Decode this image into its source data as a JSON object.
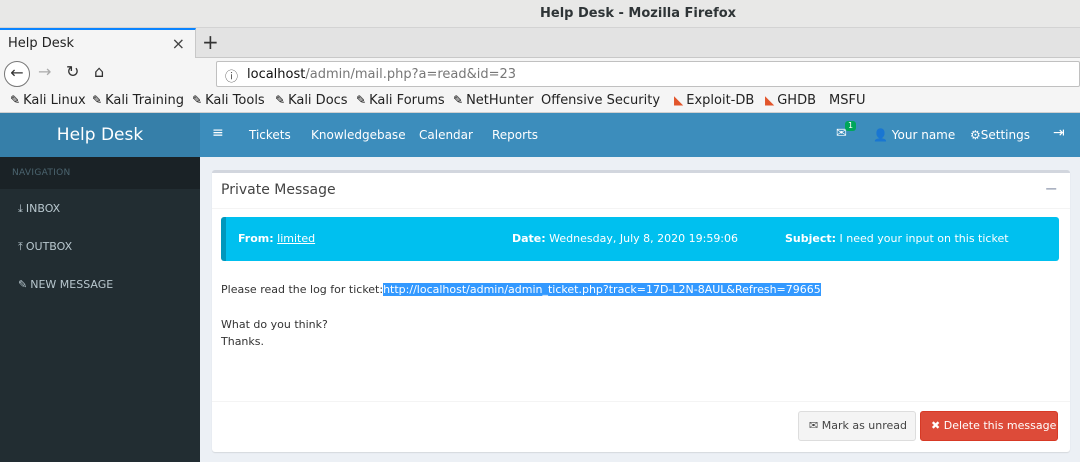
{
  "window": {
    "title": "Help Desk - Mozilla Firefox"
  },
  "tab": {
    "label": "Help Desk",
    "close": "×",
    "new": "+"
  },
  "nav": {
    "back": "←",
    "forward": "→",
    "reload": "↻",
    "home": "⌂",
    "info_icon": "ⓘ",
    "url_host": "localhost",
    "url_path": "/admin/mail.php?a=read&id=23"
  },
  "bookmarks": [
    {
      "icon": "dragon",
      "label": "Kali Linux"
    },
    {
      "icon": "dragon",
      "label": "Kali Training"
    },
    {
      "icon": "dragon",
      "label": "Kali Tools"
    },
    {
      "icon": "dragon",
      "label": "Kali Docs"
    },
    {
      "icon": "dragon",
      "label": "Kali Forums"
    },
    {
      "icon": "dragon",
      "label": "NetHunter"
    },
    {
      "icon": "offsec",
      "label": "Offensive Security"
    },
    {
      "icon": "exploitdb",
      "label": "Exploit-DB"
    },
    {
      "icon": "exploitdb",
      "label": "GHDB"
    },
    {
      "icon": "offsec",
      "label": "MSFU"
    }
  ],
  "app": {
    "brand": "Help Desk",
    "menu": [
      "Tickets",
      "Knowledgebase",
      "Calendar",
      "Reports"
    ],
    "mail_count": "1",
    "user": "Your name",
    "settings": "Settings"
  },
  "sidebar": {
    "header": "NAVIGATION",
    "items": [
      {
        "icon": "download-icon",
        "label": "INBOX"
      },
      {
        "icon": "upload-icon",
        "label": "OUTBOX"
      },
      {
        "icon": "edit-icon",
        "label": "NEW MESSAGE"
      }
    ]
  },
  "message": {
    "box_title": "Private Message",
    "from_label": "From:",
    "from_value": "limited",
    "date_label": "Date:",
    "date_value": "Wednesday, July 8, 2020 19:59:06",
    "subject_label": "Subject:",
    "subject_value": "I need your input on this ticket",
    "line1_prefix": "Please read the log for ticket:",
    "line1_link": "http://localhost/admin/admin_ticket.php?track=17D-L2N-8AUL&Refresh=79665",
    "line2": "What do you think?",
    "line3": "Thanks.",
    "btn_unread": "Mark as unread",
    "btn_delete": "Delete this message"
  },
  "colors": {
    "header_blue": "#3c8dbc",
    "brand_blue": "#367fa9",
    "sidebar_dark": "#222d32",
    "callout": "#00c0ef",
    "danger": "#dd4b39"
  }
}
